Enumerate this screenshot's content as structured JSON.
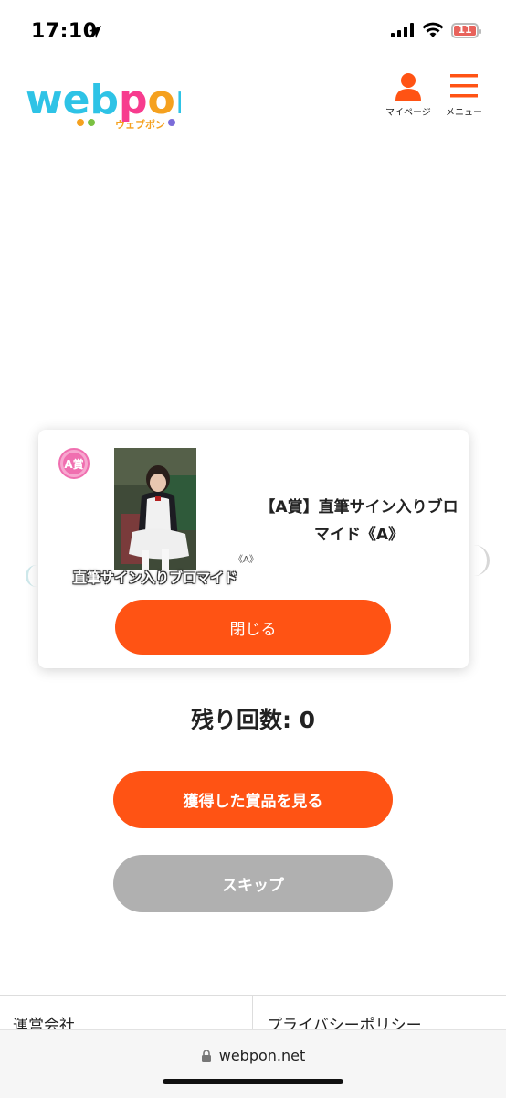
{
  "status_bar": {
    "time": "17:10",
    "battery": "11"
  },
  "header": {
    "logo_text": "webpon",
    "logo_sub": "ウェブポン",
    "mypage_label": "マイページ",
    "menu_label": "メニュー"
  },
  "modal": {
    "badge_text": "A賞",
    "prize_caption": "直筆サイン入りブロマイド",
    "prize_caption_suffix": "《A》",
    "prize_title": "【A賞】直筆サイン入りブロマイド《A》",
    "close_label": "閉じる"
  },
  "main": {
    "remaining_label": "残り回数: 0",
    "view_prizes_label": "獲得した賞品を見る",
    "skip_label": "スキップ"
  },
  "footer": {
    "company_label": "運営会社",
    "privacy_label": "プライバシーポリシー"
  },
  "browser": {
    "url": "webpon.net"
  },
  "colors": {
    "accent": "#ff5314",
    "disabled": "#b0b0b0",
    "header_icon": "#ff5314"
  }
}
